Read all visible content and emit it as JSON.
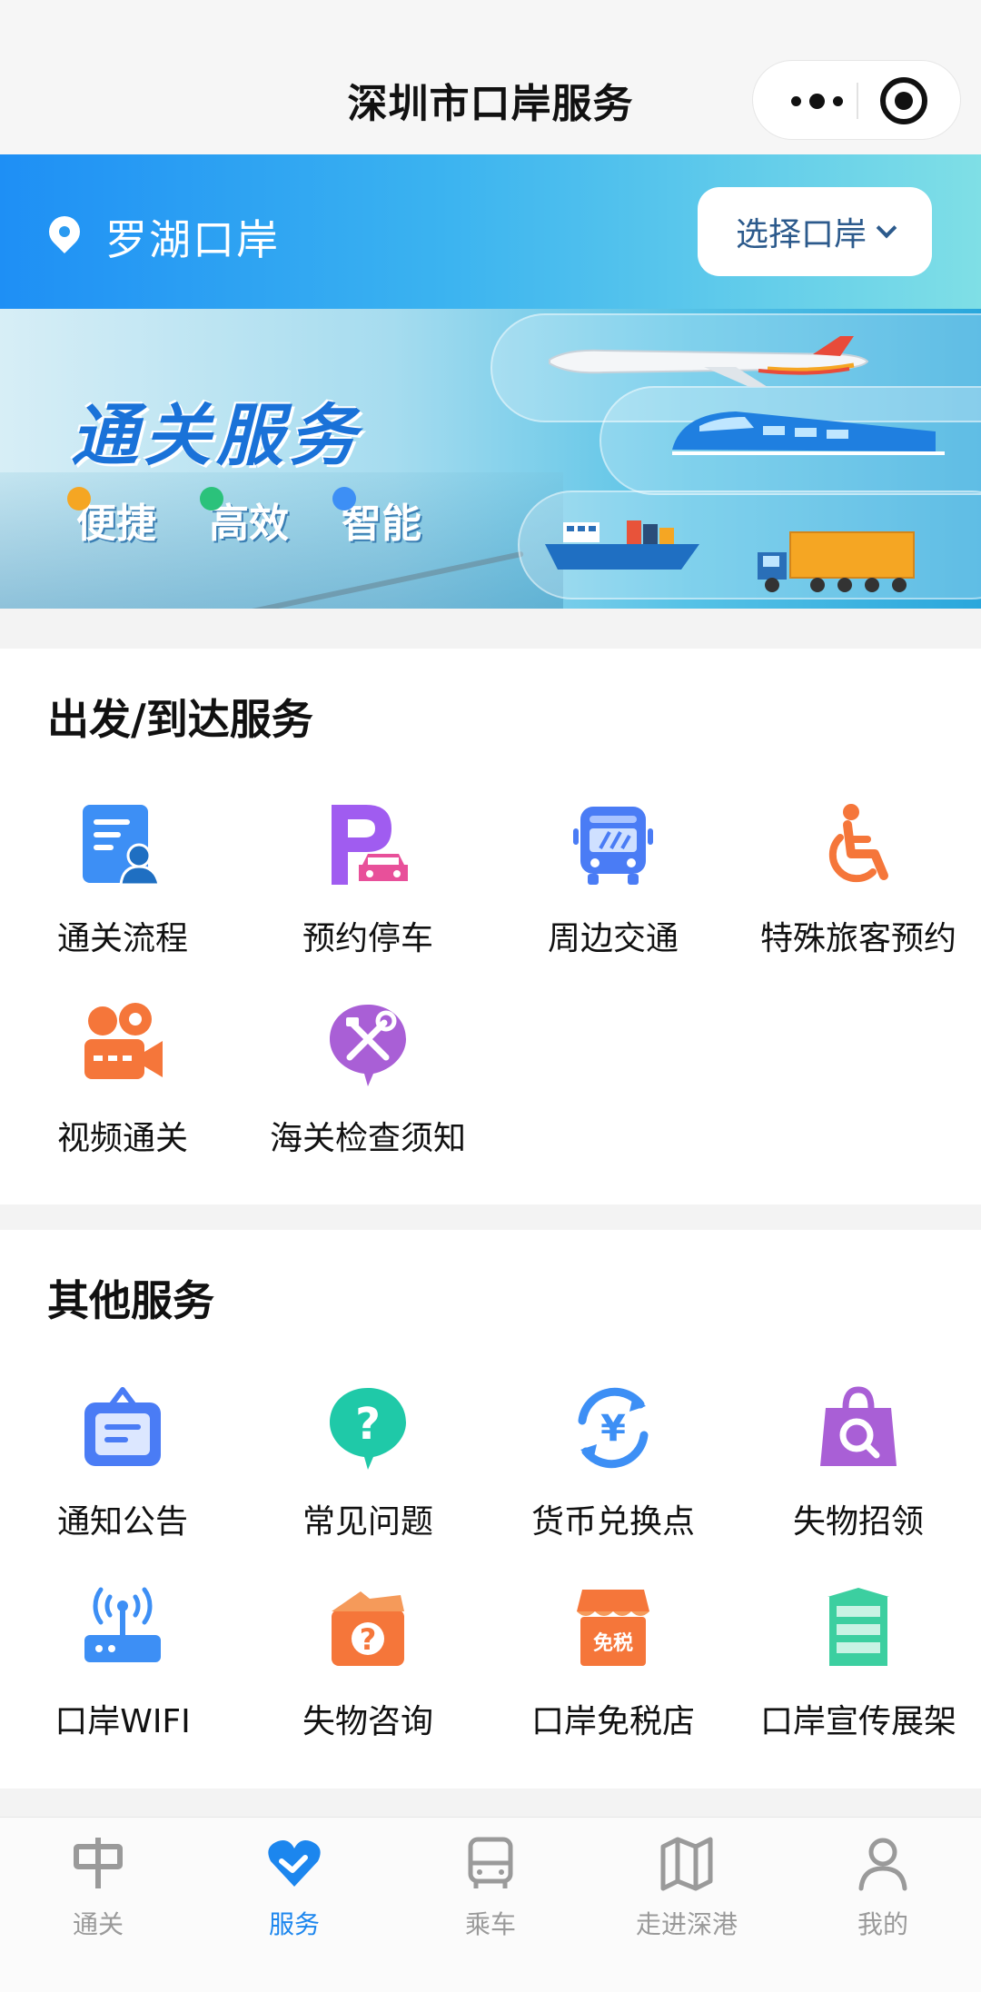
{
  "titlebar": {
    "title": "深圳市口岸服务"
  },
  "location": {
    "name": "罗湖口岸",
    "select_label": "选择口岸"
  },
  "banner": {
    "headline": "通关服务",
    "tags": [
      "便捷",
      "高效",
      "智能"
    ]
  },
  "departure_section": {
    "title": "出发/到达服务",
    "items": [
      {
        "label": "通关流程",
        "icon": "document-person-icon"
      },
      {
        "label": "预约停车",
        "icon": "parking-icon"
      },
      {
        "label": "周边交通",
        "icon": "bus-icon"
      },
      {
        "label": "特殊旅客预约",
        "icon": "wheelchair-icon"
      },
      {
        "label": "视频通关",
        "icon": "video-camera-icon"
      },
      {
        "label": "海关检查须知",
        "icon": "tools-icon"
      }
    ]
  },
  "other_section": {
    "title": "其他服务",
    "items": [
      {
        "label": "通知公告",
        "icon": "notice-board-icon"
      },
      {
        "label": "常见问题",
        "icon": "question-bubble-icon"
      },
      {
        "label": "货币兑换点",
        "icon": "currency-exchange-icon"
      },
      {
        "label": "失物招领",
        "icon": "lost-bag-search-icon"
      },
      {
        "label": "口岸WIFI",
        "icon": "wifi-router-icon"
      },
      {
        "label": "失物咨询",
        "icon": "question-box-icon"
      },
      {
        "label": "口岸免税店",
        "icon": "duty-free-shop-icon",
        "badge": "免税"
      },
      {
        "label": "口岸宣传展架",
        "icon": "display-shelf-icon"
      }
    ]
  },
  "tabbar": {
    "active_index": 1,
    "items": [
      {
        "label": "通关",
        "icon": "customs-icon"
      },
      {
        "label": "服务",
        "icon": "service-heart-icon"
      },
      {
        "label": "乘车",
        "icon": "bus-icon"
      },
      {
        "label": "走进深港",
        "icon": "map-icon"
      },
      {
        "label": "我的",
        "icon": "user-icon"
      }
    ]
  },
  "colors": {
    "accent": "#1c86ee",
    "tab_inactive": "#9a9a9a"
  }
}
